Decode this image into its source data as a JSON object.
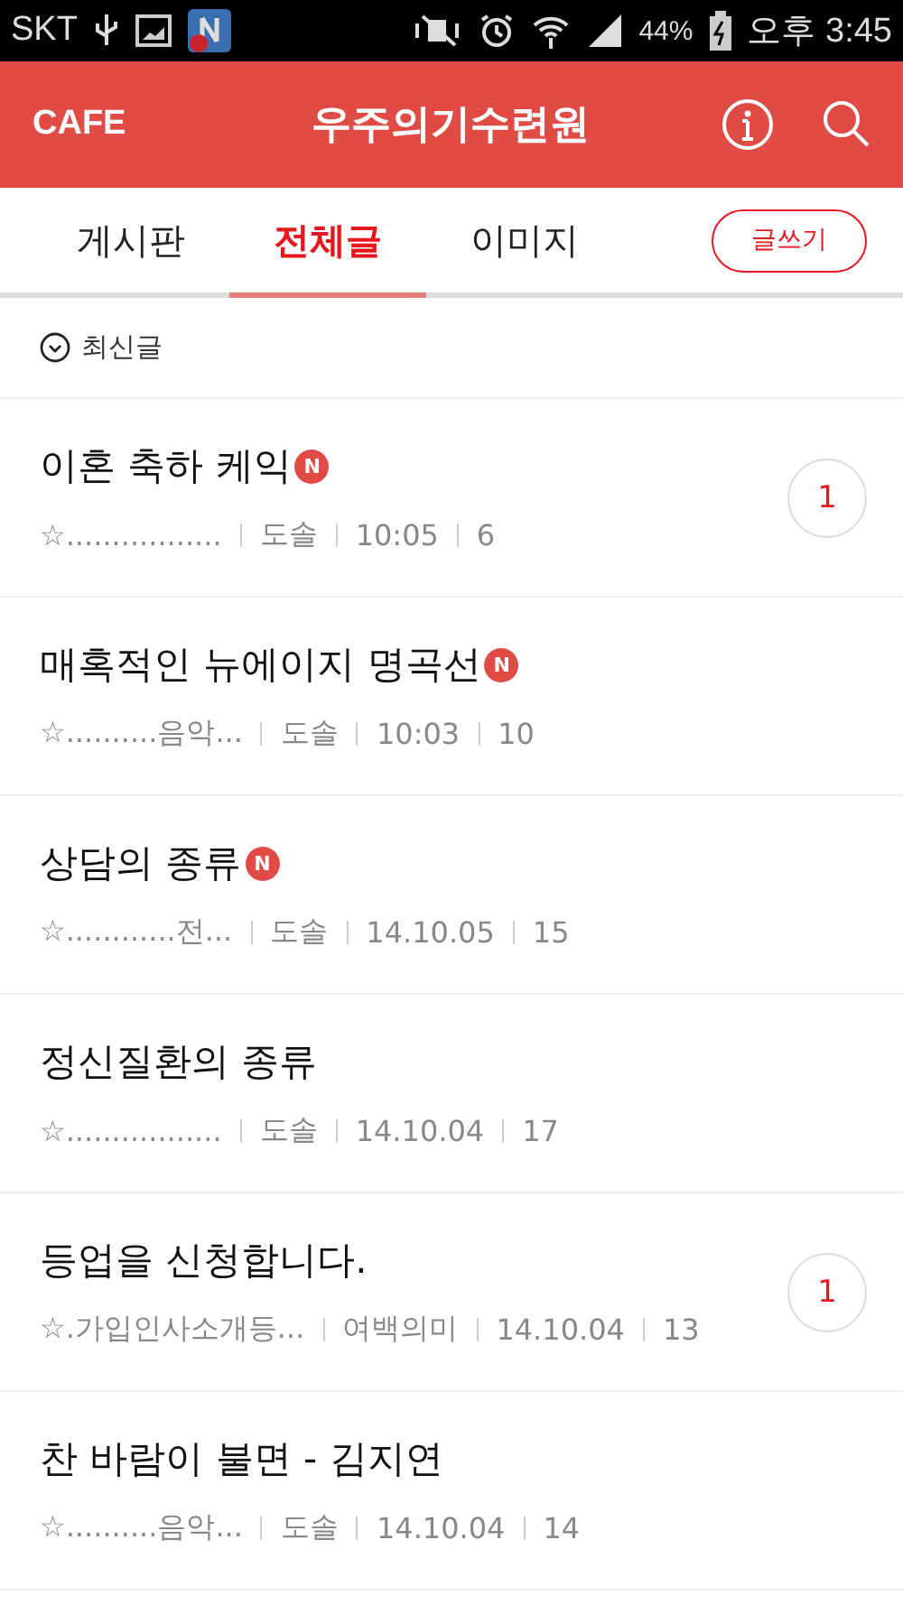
{
  "status_bar": {
    "carrier": "SKT",
    "battery": "44%",
    "time": "오후 3:45"
  },
  "header": {
    "logo": "CAFE",
    "title": "우주의기수련원"
  },
  "tabs": [
    {
      "label": "게시판",
      "selected": false
    },
    {
      "label": "전체글",
      "selected": true
    },
    {
      "label": "이미지",
      "selected": false
    }
  ],
  "write_button": "글쓰기",
  "sort": {
    "label": "최신글"
  },
  "posts": [
    {
      "title": "이혼 축하 케익",
      "badge": "N",
      "board": "☆.................",
      "author": "도솔",
      "time": "10:05",
      "views": "6",
      "comments": "1"
    },
    {
      "title": "매혹적인 뉴에이지 명곡선",
      "badge": "N",
      "board": "☆..........음악...",
      "author": "도솔",
      "time": "10:03",
      "views": "10"
    },
    {
      "title": "상담의 종류",
      "badge": "N",
      "board": "☆............전...",
      "author": "도솔",
      "time": "14.10.05",
      "views": "15"
    },
    {
      "title": "정신질환의 종류",
      "board": "☆.................",
      "author": "도솔",
      "time": "14.10.04",
      "views": "17"
    },
    {
      "title": "등업을 신청합니다.",
      "board": "☆.가입인사소개등...",
      "author": "여백의미",
      "time": "14.10.04",
      "views": "13",
      "comments": "1"
    },
    {
      "title": "찬 바람이 불면 - 김지연",
      "board": "☆..........음악...",
      "author": "도솔",
      "time": "14.10.04",
      "views": "14"
    }
  ]
}
